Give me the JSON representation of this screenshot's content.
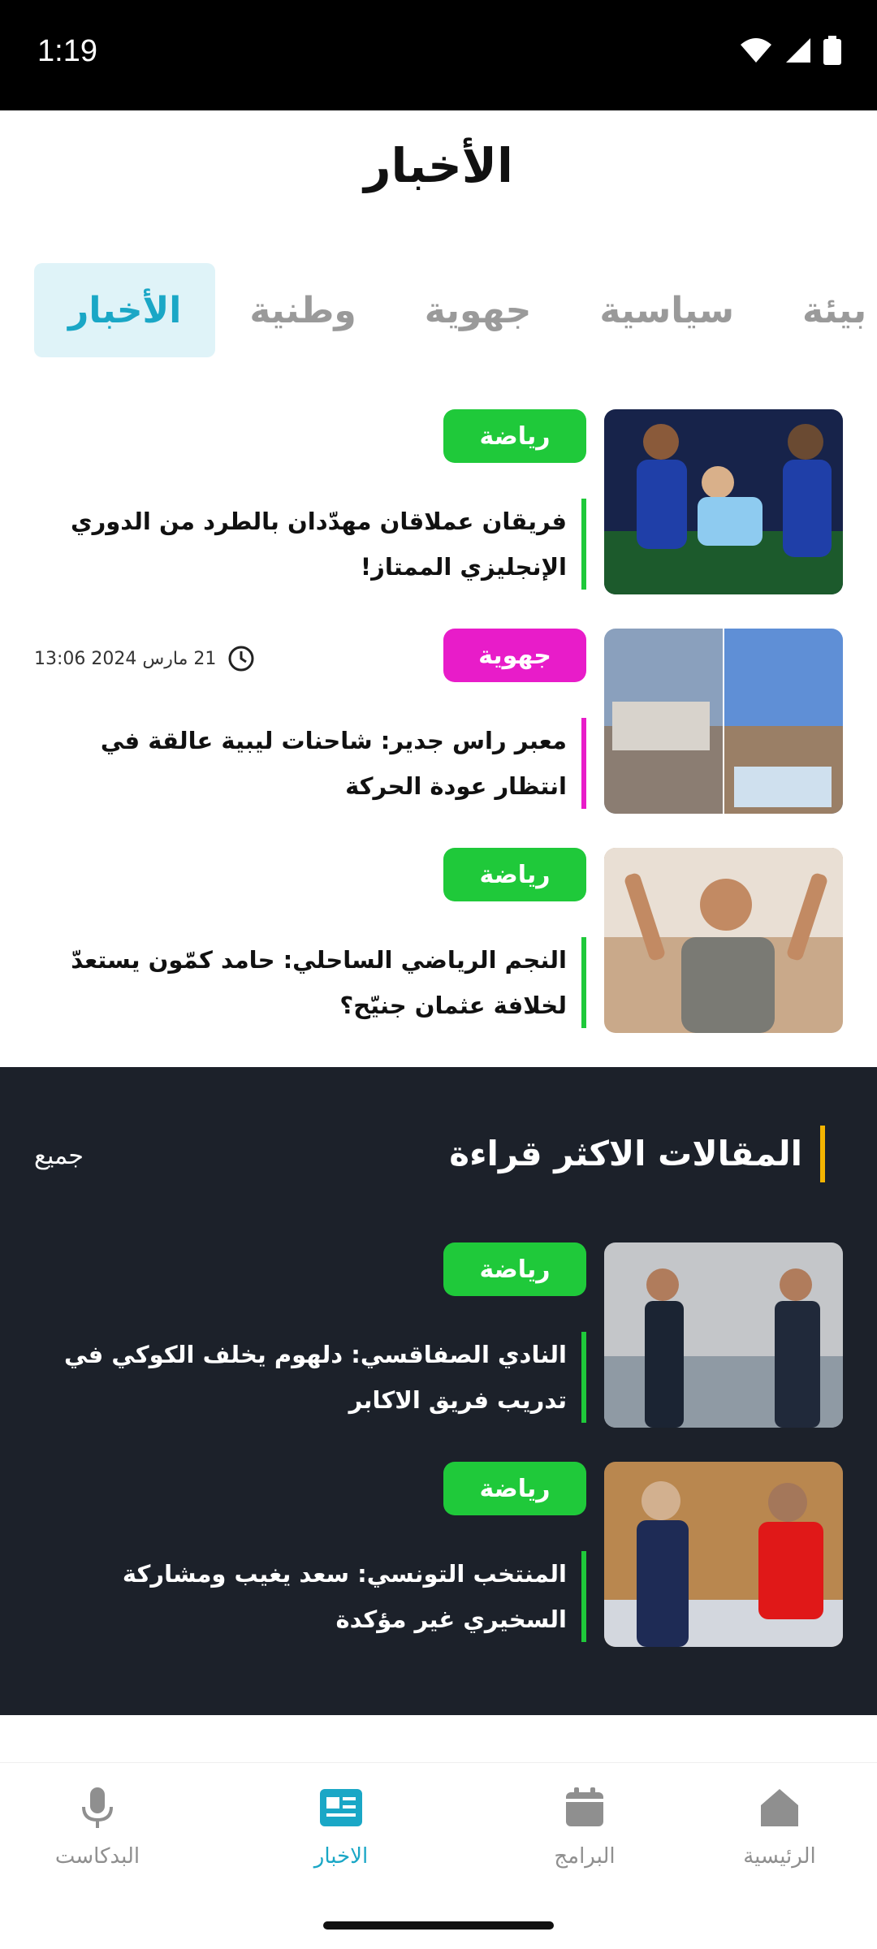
{
  "status_bar": {
    "time": "1:19"
  },
  "header": {
    "title": "الأخبار"
  },
  "tabs": [
    {
      "label": "الأخبار",
      "active": true
    },
    {
      "label": "وطنية",
      "active": false
    },
    {
      "label": "جهوية",
      "active": false
    },
    {
      "label": "سياسية",
      "active": false
    },
    {
      "label": "بيئة",
      "active": false
    }
  ],
  "news": [
    {
      "badge": "رياضة",
      "badge_color": "#1fc93a",
      "title": "فريقان عملاقان مهدّدان بالطرد من الدوري الإنجليزي الممتاز!"
    },
    {
      "badge": "جهوية",
      "badge_color": "#e81cc9",
      "title": "معبر راس جدير: شاحنات ليبية عالقة في انتظار عودة الحركة",
      "date": "21 مارس 2024 13:06"
    },
    {
      "badge": "رياضة",
      "badge_color": "#1fc93a",
      "title": "النجم الرياضي الساحلي: حامد كمّون يستعدّ لخلافة عثمان جنيّح؟"
    }
  ],
  "most_read": {
    "title": "المقالات الاكثر قراءة",
    "see_all": "جميع",
    "items": [
      {
        "badge": "رياضة",
        "badge_color": "#1fc93a",
        "title": "النادي الصفاقسي: دلهوم يخلف الكوكي في تدريب فريق الاكابر"
      },
      {
        "badge": "رياضة",
        "badge_color": "#1fc93a",
        "title": "المنتخب التونسي: سعد يغيب ومشاركة السخيري غير مؤكدة"
      }
    ]
  },
  "bottom_nav": [
    {
      "label": "الرئيسية",
      "icon": "home-icon",
      "active": false
    },
    {
      "label": "البرامج",
      "icon": "calendar-icon",
      "active": false
    },
    {
      "label": "الاخبار",
      "icon": "news-icon",
      "active": true
    },
    {
      "label": "البدكاست",
      "icon": "microphone-icon",
      "active": false
    }
  ],
  "colors": {
    "accent": "#1aa7c6",
    "sport_badge": "#1fc93a",
    "regional_badge": "#e81cc9",
    "dark_bg": "#1c212a",
    "section_bar": "#f4b400"
  }
}
